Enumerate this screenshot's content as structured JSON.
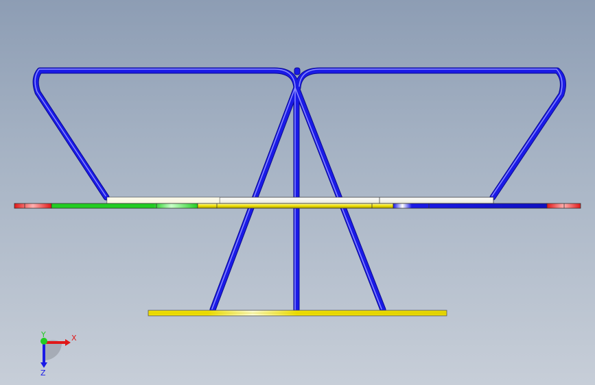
{
  "viewport": {
    "background_top": "#8d9db4",
    "background_bottom": "#c7ced8"
  },
  "model": {
    "tube_color": "#1a1ae6",
    "colors": {
      "red": "#e01818",
      "green": "#22cc22",
      "yellow": "#f0e000",
      "white": "#ffffff",
      "blue": "#1a1ae6"
    }
  },
  "triad": {
    "x_label": "X",
    "y_label": "Y",
    "z_label": "Z",
    "x_color": "#e01818",
    "y_color": "#22cc22",
    "z_color": "#1a1ae6"
  }
}
